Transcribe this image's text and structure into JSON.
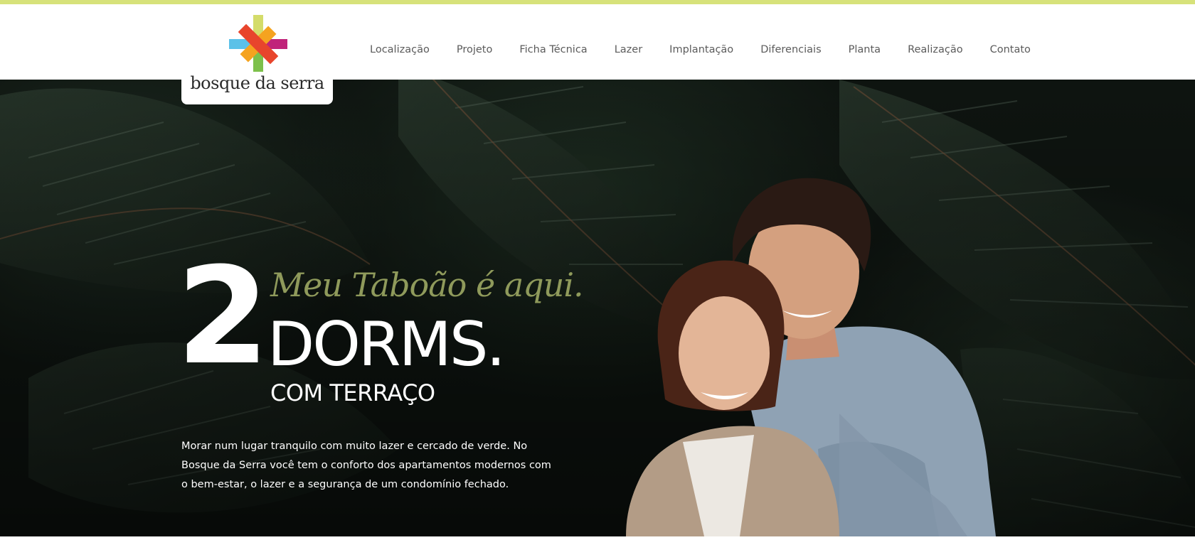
{
  "brand": {
    "name": "bosque da serra",
    "colors": {
      "top_line": "#d7e27a",
      "logo_red": "#e8452c",
      "logo_orange": "#f5a31f",
      "logo_green": "#7dc04b",
      "logo_blue": "#5bc1e8",
      "logo_magenta": "#c0247a",
      "logo_lime": "#d4dc6a"
    },
    "logo_icon": "asterisk-logo-icon"
  },
  "nav": {
    "items": [
      {
        "label": "Localização"
      },
      {
        "label": "Projeto"
      },
      {
        "label": "Ficha Técnica"
      },
      {
        "label": "Lazer"
      },
      {
        "label": "Implantação"
      },
      {
        "label": "Diferenciais"
      },
      {
        "label": "Planta"
      },
      {
        "label": "Realização"
      },
      {
        "label": "Contato"
      }
    ]
  },
  "hero": {
    "number": "2",
    "tagline": "Meu Taboão é aqui.",
    "headline": "DORMS.",
    "subheadline": "COM TERRAÇO",
    "description": "Morar num lugar tranquilo com muito lazer e cercado de verde. No Bosque da Serra você tem o conforto dos apartamentos modernos com o bem-estar, o lazer e a segurança de um condomínio fechado.",
    "tagline_color": "#8f9a5b",
    "image": "smiling-couple-photo"
  }
}
